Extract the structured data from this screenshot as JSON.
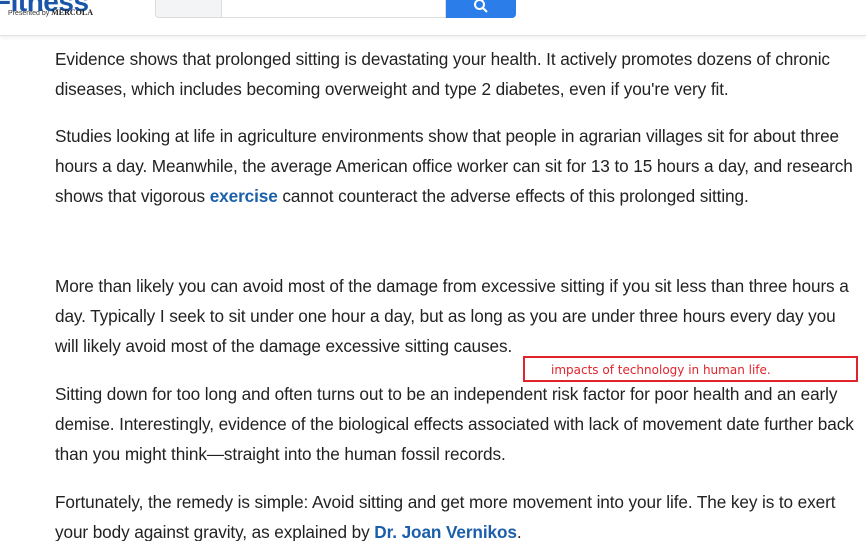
{
  "header": {
    "logo_text": "Fitness",
    "logo_presented_by": "Presented by",
    "logo_brand": "MERCOLA",
    "search": {
      "placeholder": "",
      "value": "",
      "select_value": "",
      "button_icon": "search-icon"
    }
  },
  "colors": {
    "link": "#1b5faa",
    "search_button": "#2b7de9",
    "annotation": "#e0242b",
    "logo": "#1a56a8"
  },
  "article": {
    "p1": "Evidence shows that prolonged sitting is devastating your health. It actively promotes dozens of chronic diseases, which includes becoming overweight and type 2 diabetes, even if you're very fit.",
    "p2_before": "Studies looking at life in agriculture environments show that people in agrarian villages sit for about three hours a day. Meanwhile, the average American office worker can sit for 13 to 15 hours a day, and research shows that vigorous ",
    "p2_link": "exercise",
    "p2_after": " cannot counteract the adverse effects of this prolonged sitting.",
    "p3": "More than likely you can avoid most of the damage from excessive sitting if you sit less than three hours a day. Typically I seek to sit under one hour a day, but as long as you are under three hours every day you will likely avoid most of the damage excessive sitting causes.",
    "p4": "Sitting down for too long and often turns out to be an independent risk factor for poor health and an early demise. Interestingly, evidence of the biological effects associated with lack of movement date further back than you might think—straight into the human fossil records.",
    "p5_before": "Fortunately, the remedy is simple: Avoid sitting and get more movement into your life. The key is to exert your body against gravity, as explained by ",
    "p5_link": "Dr. Joan Vernikos",
    "p5_after": "."
  },
  "annotation": {
    "text": "impacts of technology in human life."
  }
}
